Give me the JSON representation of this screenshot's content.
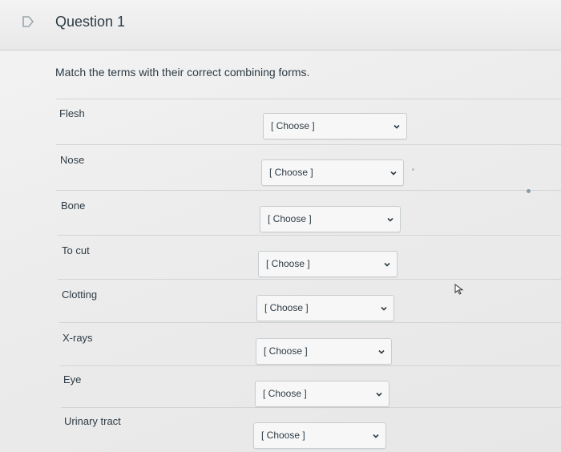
{
  "question": {
    "title": "Question 1",
    "prompt": "Match the terms with their correct combining forms."
  },
  "rows": [
    {
      "term": "Flesh",
      "selected": "[ Choose ]"
    },
    {
      "term": "Nose",
      "selected": "[ Choose ]"
    },
    {
      "term": "Bone",
      "selected": "[ Choose ]"
    },
    {
      "term": "To cut",
      "selected": "[ Choose ]"
    },
    {
      "term": "Clotting",
      "selected": "[ Choose ]"
    },
    {
      "term": "X-rays",
      "selected": "[ Choose ]"
    },
    {
      "term": "Eye",
      "selected": "[ Choose ]"
    },
    {
      "term": "Urinary tract",
      "selected": "[ Choose ]"
    }
  ],
  "icons": {
    "flag": "flag-outline-icon",
    "chevron": "chevron-down-icon",
    "cursor": "mouse-pointer-icon"
  },
  "colors": {
    "text": "#2d3b45",
    "select_border": "#c7cdd1",
    "background": "#ececec"
  }
}
